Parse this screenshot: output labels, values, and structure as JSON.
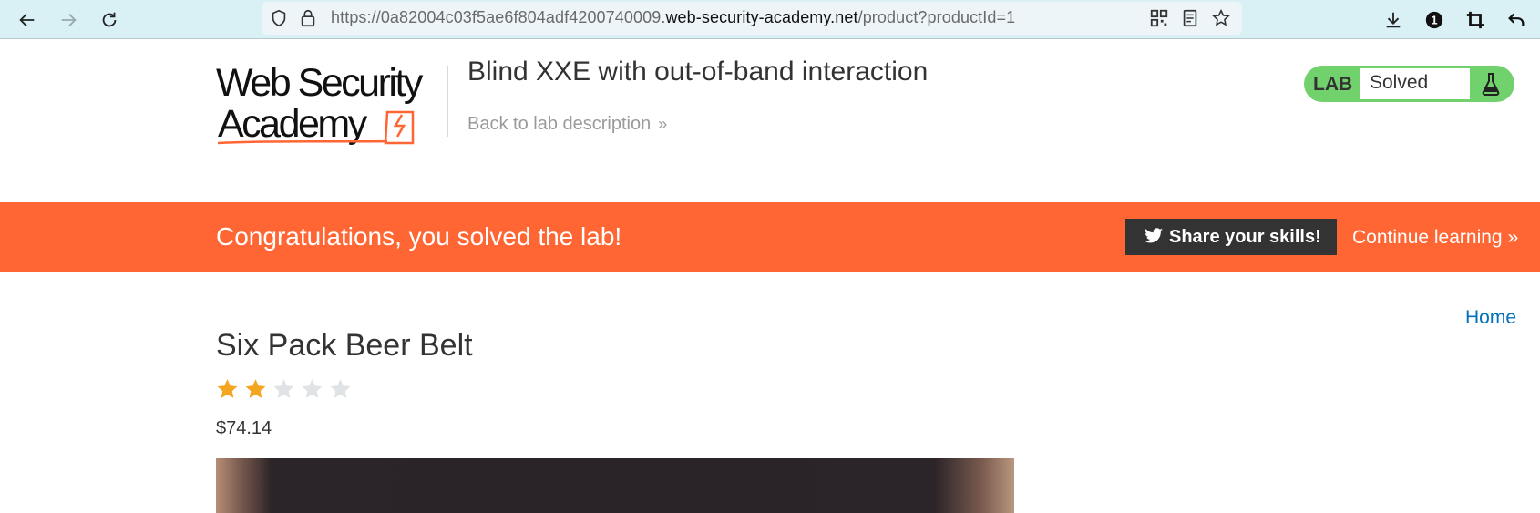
{
  "browser": {
    "url_prefix": "https://0a82004c03f5ae6f804adf4200740009.",
    "url_host": "web-security-academy.net",
    "url_path": "/product?productId=1",
    "notification_count": "1",
    "icons": [
      "back-icon",
      "forward-icon",
      "reload-icon",
      "shield-icon",
      "lock-icon",
      "qr-code-icon",
      "reader-view-icon",
      "bookmark-star-icon",
      "download-icon",
      "extension-badge-icon",
      "crop-icon",
      "undo-icon"
    ]
  },
  "header": {
    "logo_line1": "Web Security",
    "logo_line2": "Academy",
    "lab_title": "Blind XXE with out-of-band interaction",
    "back_link": "Back to lab description",
    "back_chevron": "»",
    "lab_status_label": "LAB",
    "lab_status_value": "Solved"
  },
  "banner": {
    "message": "Congratulations, you solved the lab!",
    "share_button": "Share your skills!",
    "continue_link": "Continue learning",
    "continue_chevron": "»"
  },
  "product": {
    "home_link": "Home",
    "title": "Six Pack Beer Belt",
    "rating": 2,
    "rating_max": 5,
    "price": "$74.14"
  },
  "colors": {
    "banner": "#ff6633",
    "lab_status": "#70d16d",
    "star_filled": "#f4a623",
    "star_empty": "#dfe3e6",
    "link": "#0071bc",
    "toolbar": "#d9f0f4"
  }
}
